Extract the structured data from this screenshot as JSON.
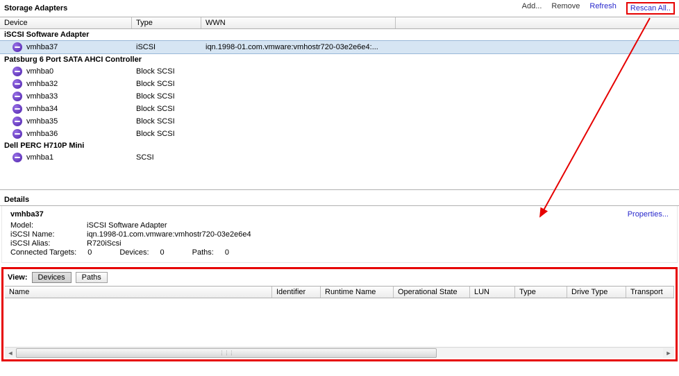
{
  "header": {
    "title": "Storage Adapters",
    "actions": {
      "add": "Add...",
      "remove": "Remove",
      "refresh": "Refresh",
      "rescan": "Rescan All.."
    }
  },
  "columns": {
    "device": "Device",
    "type": "Type",
    "wwn": "WWN"
  },
  "adapters": {
    "groups": [
      {
        "name": "iSCSI Software Adapter",
        "rows": [
          {
            "device": "vmhba37",
            "type": "iSCSI",
            "wwn": "iqn.1998-01.com.vmware:vmhostr720-03e2e6e4:...",
            "selected": true
          }
        ]
      },
      {
        "name": "Patsburg 6 Port SATA AHCI Controller",
        "rows": [
          {
            "device": "vmhba0",
            "type": "Block SCSI",
            "wwn": ""
          },
          {
            "device": "vmhba32",
            "type": "Block SCSI",
            "wwn": ""
          },
          {
            "device": "vmhba33",
            "type": "Block SCSI",
            "wwn": ""
          },
          {
            "device": "vmhba34",
            "type": "Block SCSI",
            "wwn": ""
          },
          {
            "device": "vmhba35",
            "type": "Block SCSI",
            "wwn": ""
          },
          {
            "device": "vmhba36",
            "type": "Block SCSI",
            "wwn": ""
          }
        ]
      },
      {
        "name": "Dell PERC H710P Mini",
        "rows": [
          {
            "device": "vmhba1",
            "type": "SCSI",
            "wwn": ""
          }
        ]
      }
    ]
  },
  "details": {
    "section_title": "Details",
    "properties_link": "Properties...",
    "name": "vmhba37",
    "labels": {
      "model": "Model:",
      "iscsi_name": "iSCSI Name:",
      "iscsi_alias": "iSCSI Alias:",
      "connected_targets": "Connected Targets:",
      "devices": "Devices:",
      "paths": "Paths:"
    },
    "values": {
      "model": "iSCSI Software Adapter",
      "iscsi_name": "iqn.1998-01.com.vmware:vmhostr720-03e2e6e4",
      "iscsi_alias": "R720iScsi",
      "connected_targets": "0",
      "devices": "0",
      "paths": "0"
    }
  },
  "view": {
    "label": "View:",
    "buttons": {
      "devices": "Devices",
      "paths": "Paths"
    },
    "columns": {
      "name": "Name",
      "identifier": "Identifier",
      "runtime": "Runtime Name",
      "opstate": "Operational State",
      "lun": "LUN",
      "type": "Type",
      "drivetype": "Drive Type",
      "transport": "Transport"
    }
  }
}
